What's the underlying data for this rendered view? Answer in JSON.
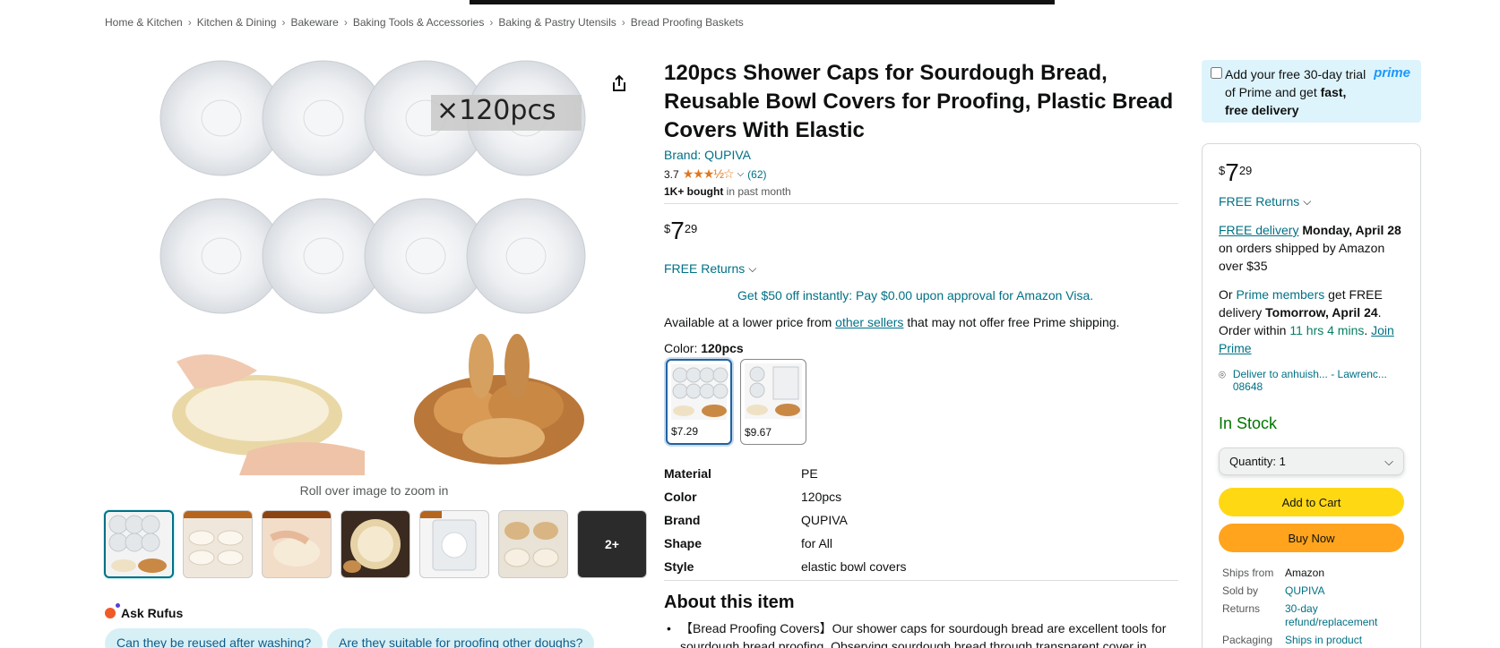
{
  "breadcrumb": [
    "Home & Kitchen",
    "Kitchen & Dining",
    "Bakeware",
    "Baking Tools & Accessories",
    "Baking & Pastry Utensils",
    "Bread Proofing Baskets"
  ],
  "gallery": {
    "badge": "×120pcs",
    "zoom_hint": "Roll over image to zoom in",
    "more_label": "2+"
  },
  "product": {
    "title": "120pcs Shower Caps for Sourdough Bread, Reusable Bowl Covers for Proofing, Plastic Bread Covers With Elastic",
    "brand": "Brand: QUPIVA",
    "rating_value": "3.7",
    "rating_count": "(62)",
    "bought_bold": "1K+ bought",
    "bought_rest": " in past month",
    "price_symbol": "$",
    "price_whole": "7",
    "price_fraction": "29",
    "free_returns": "FREE Returns",
    "visa_offer": "Get $50 off instantly: Pay $0.00 upon approval for Amazon Visa.",
    "lower_price_before": "Available at a lower price from ",
    "lower_price_link": "other sellers",
    "lower_price_after": " that may not offer free Prime shipping.",
    "color_label": "Color: ",
    "color_value": "120pcs",
    "swatches": [
      {
        "price": "$7.29"
      },
      {
        "price": "$9.67"
      }
    ],
    "specs": [
      {
        "k": "Material",
        "v": "PE"
      },
      {
        "k": "Color",
        "v": "120pcs"
      },
      {
        "k": "Brand",
        "v": "QUPIVA"
      },
      {
        "k": "Shape",
        "v": "for All"
      },
      {
        "k": "Style",
        "v": "elastic bowl covers"
      }
    ],
    "about_title": "About this item",
    "about_bullet": "【Bread Proofing Covers】Our shower caps for sourdough bread are excellent tools for sourdough bread proofing. Observing sourdough bread through transparent cover in"
  },
  "rufus": {
    "label": "Ask Rufus",
    "q1": "Can they be reused after washing?",
    "q2": "Are they suitable for proofing other doughs?"
  },
  "prime": {
    "text_plain": "Add your free 30-day trial of Prime and get ",
    "text_bold": "fast, free delivery",
    "logo": "prime"
  },
  "buybox": {
    "price_symbol": "$",
    "price_whole": "7",
    "price_fraction": "29",
    "free_returns": "FREE Returns",
    "delivery_link": "FREE delivery",
    "delivery_date": "Monday, April 28",
    "delivery_rest": " on orders shipped by Amazon over $35",
    "fast_or": "Or ",
    "fast_link": "Prime members",
    "fast_mid": " get FREE delivery ",
    "fast_date": "Tomorrow, April 24",
    "fast_order": ". Order within ",
    "fast_time": "11 hrs 4 mins",
    "fast_join": "Join Prime",
    "deliver_to": "Deliver to anhuish... - Lawrenc... 08648",
    "stock": "In Stock",
    "quantity": "Quantity:  1",
    "add_to_cart": "Add to Cart",
    "buy_now": "Buy Now",
    "ships_from_k": "Ships from",
    "ships_from_v": "Amazon",
    "sold_by_k": "Sold by",
    "sold_by_v": "QUPIVA",
    "returns_k": "Returns",
    "returns_v": "30-day refund/replacement",
    "packaging_k": "Packaging",
    "packaging_v": "Ships in product"
  },
  "colors": {
    "link": "#007185",
    "cart": "#ffd814",
    "buy": "#ffa41c",
    "stock": "#007600"
  }
}
